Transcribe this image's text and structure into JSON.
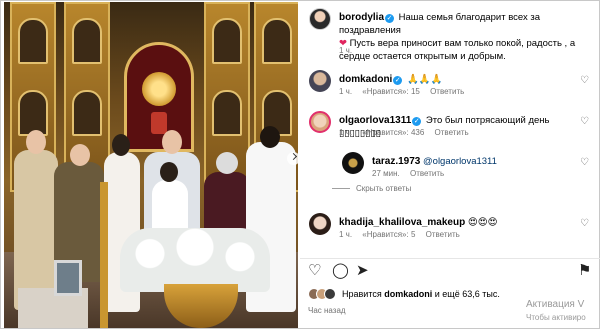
{
  "post": {
    "author": "borodylia",
    "caption": "Наша семья благодарит всех за поздравления",
    "caption_line2": "Пусть вера приносит вам только покой, радость , а сердце остается открытым и добрым.",
    "time": "1 ч."
  },
  "comments": [
    {
      "user": "domkadoni",
      "text": "🙏🙏🙏",
      "time": "1 ч.",
      "likes": "«Нравится»: 15",
      "reply": "Ответить"
    },
    {
      "user": "olgaorlova1311",
      "text": "Это был потрясающий день ▯▯▯▯▯▯▯▯",
      "time": "1 ч.",
      "likes": "«Нравится»: 436",
      "reply": "Ответить"
    },
    {
      "user": "taraz.1973",
      "mention": "@olgaorlova1311",
      "text": "",
      "time": "27 мин.",
      "reply": "Ответить"
    },
    {
      "user": "khadija_khalilova_makeup",
      "text": "😍😍😍",
      "time": "1 ч.",
      "likes": "«Нравится»: 5",
      "reply": "Ответить"
    }
  ],
  "hide_replies": "Скрыть ответы",
  "likes_summary": {
    "prefix": "Нравится",
    "user": "domkadoni",
    "suffix": "и ещё 63,6 тыс."
  },
  "posted": "Час назад",
  "watermark": {
    "line1": "Активация V",
    "line2": "Чтобы активиро"
  },
  "colors": {
    "verified": "#1d9bf0",
    "heart": "#e0245e",
    "mention": "#00376b"
  }
}
